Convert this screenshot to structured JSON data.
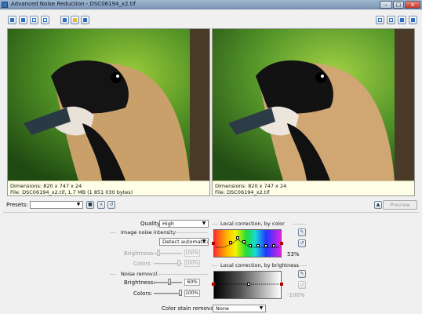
{
  "window": {
    "title": "Advanced Noise Reduction - DSC06194_x2.tif",
    "minimize": "–",
    "maximize": "□",
    "close": "x"
  },
  "viewers": [
    {
      "dimensions": "Dimensions: 820 x 747 x 24",
      "file": "File: DSC06194_x2.tif, 1.7 MB (1 851 030 bytes)"
    },
    {
      "dimensions": "Dimensions: 820 x 747 x 24",
      "file": "File: DSC06194_x2.tif"
    }
  ],
  "presets": {
    "label": "Presets:",
    "value": ""
  },
  "preview_label": "Preview",
  "quality": {
    "label": "Quality:",
    "value": "High"
  },
  "noise_intensity": {
    "title": "Image noise intensity",
    "mode": "Detect automatically",
    "brightness_label": "Brightness",
    "brightness_value": "100%",
    "colors_label": "Colors",
    "colors_value": "100%"
  },
  "noise_removal": {
    "title": "Noise removal",
    "brightness_label": "Brightness:",
    "brightness_value": "60%",
    "colors_label": "Colors:",
    "colors_value": "100%"
  },
  "local_color": {
    "title": "Local correction, by color",
    "value": "53%"
  },
  "local_brightness": {
    "title": "Local correction, by brightness",
    "value": "-100%"
  },
  "color_stain": {
    "label": "Color stain removal:",
    "value": "None"
  },
  "colors": {
    "titlebar": "#8aa3c1",
    "info_bg": "#ffffe8",
    "accent": "#2f6fc0"
  },
  "icons": {
    "zoom_in": "zoom-in-icon",
    "zoom_out": "zoom-out-icon",
    "fit": "fit-icon",
    "full": "fullscreen-icon",
    "open": "open-folder-icon",
    "info": "info-icon",
    "layout": "layout-icon"
  }
}
